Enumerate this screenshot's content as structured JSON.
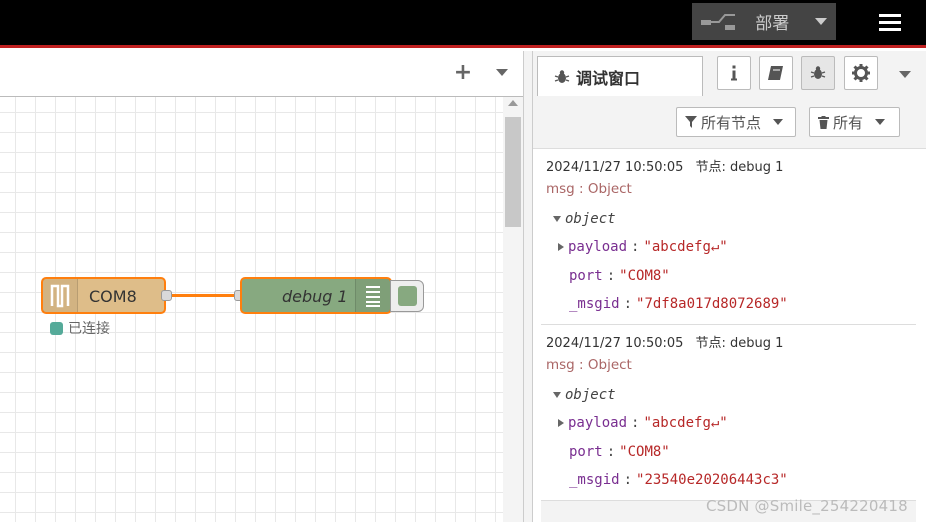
{
  "header": {
    "deploy_label": "部署"
  },
  "workspace": {
    "add_symbol": "+"
  },
  "flow": {
    "serial_node_label": "COM8",
    "serial_status_text": "已连接",
    "debug_node_label": "debug 1"
  },
  "sidebar": {
    "debug_tab_title": "调试窗口",
    "filter_nodes_label": "所有节点",
    "filter_all_label": "所有",
    "messages": [
      {
        "timestamp": "2024/11/27 10:50:05",
        "node_ref": "节点: debug 1",
        "topic": "msg : Object",
        "object_label": "object",
        "payload_key": "payload",
        "payload_value": "\"abcdefg↵\"",
        "port_key": "port",
        "port_value": "\"COM8\"",
        "msgid_key": "_msgid",
        "msgid_value": "\"7df8a017d8072689\""
      },
      {
        "timestamp": "2024/11/27 10:50:05",
        "node_ref": "节点: debug 1",
        "topic": "msg : Object",
        "object_label": "object",
        "payload_key": "payload",
        "payload_value": "\"abcdefg↵\"",
        "port_key": "port",
        "port_value": "\"COM8\"",
        "msgid_key": "_msgid",
        "msgid_value": "\"23540e20206443c3\""
      }
    ]
  },
  "watermark": "CSDN @Smile_254220418",
  "colors": {
    "header_bg": "#000000",
    "header_accent": "#c02020",
    "serial_node": "#debd89",
    "debug_node": "#87a980",
    "wire": "#ff7f0e",
    "status_connected": "#55aa99"
  }
}
